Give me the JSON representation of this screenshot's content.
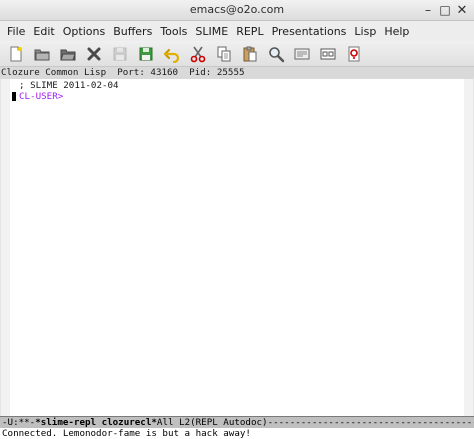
{
  "window": {
    "title": "emacs@o2o.com",
    "buttons": {
      "minimize": "–",
      "maximize": "□",
      "close": "✕"
    }
  },
  "menubar": {
    "items": [
      {
        "label": "File"
      },
      {
        "label": "Edit"
      },
      {
        "label": "Options"
      },
      {
        "label": "Buffers"
      },
      {
        "label": "Tools"
      },
      {
        "label": "SLIME"
      },
      {
        "label": "REPL"
      },
      {
        "label": "Presentations"
      },
      {
        "label": "Lisp"
      },
      {
        "label": "Help"
      }
    ]
  },
  "toolbar": {
    "icons": [
      "new-file-icon",
      "open-folder-icon",
      "open-directory-icon",
      "close-buffer-icon",
      "save-icon",
      "save-as-icon",
      "undo-icon",
      "cut-icon",
      "copy-icon",
      "paste-icon",
      "search-icon",
      "preferences-icon",
      "info-icon",
      "help-icon"
    ]
  },
  "header": {
    "lisp": "Clozure Common Lisp",
    "port_label": "Port:",
    "port": "43160",
    "pid_label": "Pid:",
    "pid": "25555"
  },
  "buffer": {
    "comment": "; SLIME 2011-02-04",
    "prompt": "CL-USER>"
  },
  "modeline": {
    "status": "-U:**-",
    "buffer_name": "*slime-repl clozurecl*",
    "position": "All L2",
    "mode": "(REPL Autodoc)",
    "dashes": "-------------------------------------------------------------------"
  },
  "echo": {
    "message": "Connected. Lemonodor-fame is but a hack away!"
  },
  "colors": {
    "prompt": "#a020f0",
    "modeline_bg": "#bfbfbf",
    "header_bg": "#d9d9d9"
  }
}
